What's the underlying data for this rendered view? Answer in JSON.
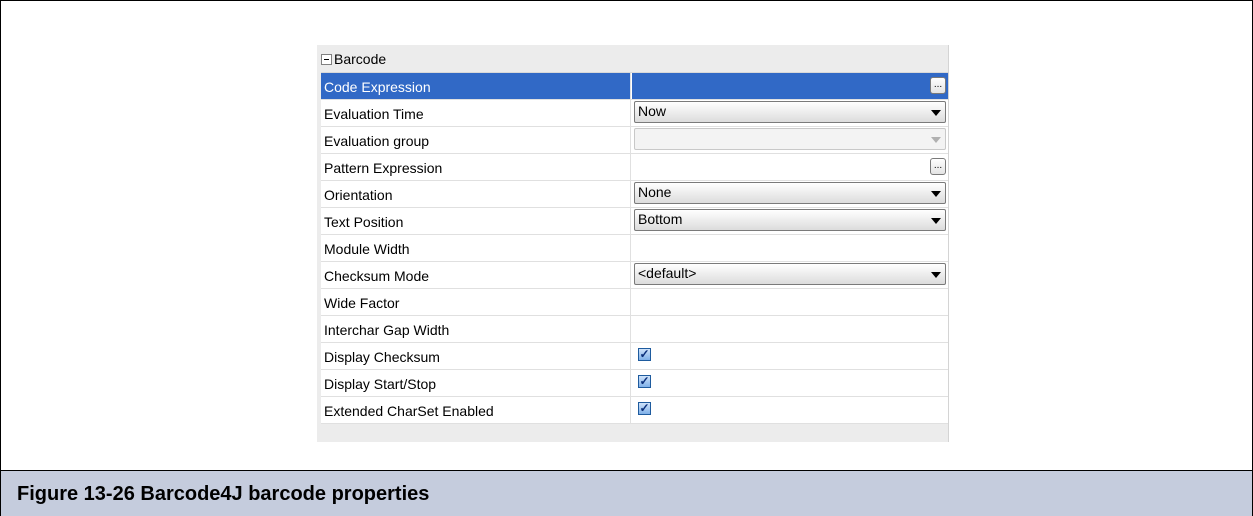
{
  "panel": {
    "group_label": "Barcode",
    "rows": [
      {
        "name": "Code Expression",
        "type": "ellipsis",
        "value": ""
      },
      {
        "name": "Evaluation Time",
        "type": "combo",
        "value": "Now"
      },
      {
        "name": "Evaluation group",
        "type": "combo-disabled",
        "value": ""
      },
      {
        "name": "Pattern Expression",
        "type": "ellipsis",
        "value": ""
      },
      {
        "name": "Orientation",
        "type": "combo",
        "value": "None"
      },
      {
        "name": "Text Position",
        "type": "combo",
        "value": "Bottom"
      },
      {
        "name": "Module Width",
        "type": "text",
        "value": ""
      },
      {
        "name": "Checksum Mode",
        "type": "combo",
        "value": "<default>"
      },
      {
        "name": "Wide Factor",
        "type": "text",
        "value": ""
      },
      {
        "name": "Interchar Gap Width",
        "type": "text",
        "value": ""
      },
      {
        "name": "Display Checksum",
        "type": "checkbox",
        "checked": true
      },
      {
        "name": "Display Start/Stop",
        "type": "checkbox",
        "checked": true
      },
      {
        "name": "Extended CharSet Enabled",
        "type": "checkbox",
        "checked": true
      }
    ],
    "ellipsis_label": "...",
    "check_mark": "✓",
    "selected_color": "#3169c6"
  },
  "caption": {
    "text": "Figure 13-26 Barcode4J barcode properties"
  }
}
